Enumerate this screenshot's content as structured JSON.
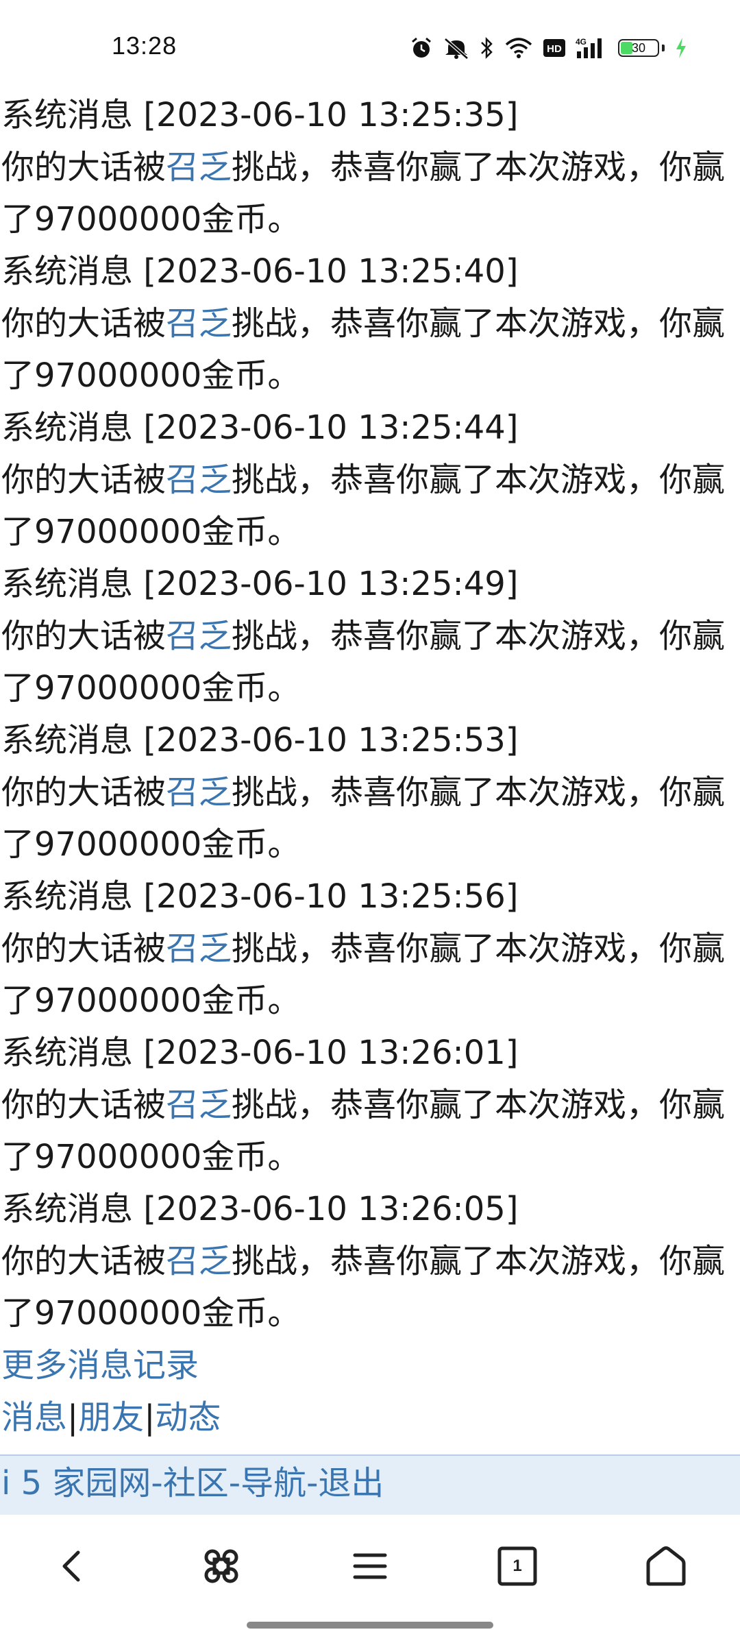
{
  "status_bar": {
    "time": "13:28",
    "battery_level": "30",
    "network": "4G",
    "hd_badge": "HD",
    "icons": [
      "alarm-icon",
      "mute-icon",
      "bluetooth-icon",
      "wifi-icon",
      "hd-icon",
      "signal-icon",
      "battery-icon",
      "charging-icon"
    ]
  },
  "messages": [
    {
      "header": "系统消息 [2023-06-10 13:25:35]",
      "pre": "你的大话被",
      "user": "召乏",
      "post": "挑战，恭喜你赢了本次游戏，你赢了97000000金币。"
    },
    {
      "header": "系统消息 [2023-06-10 13:25:40]",
      "pre": "你的大话被",
      "user": "召乏",
      "post": "挑战，恭喜你赢了本次游戏，你赢了97000000金币。"
    },
    {
      "header": "系统消息 [2023-06-10 13:25:44]",
      "pre": "你的大话被",
      "user": "召乏",
      "post": "挑战，恭喜你赢了本次游戏，你赢了97000000金币。"
    },
    {
      "header": "系统消息 [2023-06-10 13:25:49]",
      "pre": "你的大话被",
      "user": "召乏",
      "post": "挑战，恭喜你赢了本次游戏，你赢了97000000金币。"
    },
    {
      "header": "系统消息 [2023-06-10 13:25:53]",
      "pre": "你的大话被",
      "user": "召乏",
      "post": "挑战，恭喜你赢了本次游戏，你赢了97000000金币。"
    },
    {
      "header": "系统消息 [2023-06-10 13:25:56]",
      "pre": "你的大话被",
      "user": "召乏",
      "post": "挑战，恭喜你赢了本次游戏，你赢了97000000金币。"
    },
    {
      "header": "系统消息 [2023-06-10 13:26:01]",
      "pre": "你的大话被",
      "user": "召乏",
      "post": "挑战，恭喜你赢了本次游戏，你赢了97000000金币。"
    },
    {
      "header": "系统消息 [2023-06-10 13:26:05]",
      "pre": "你的大话被",
      "user": "召乏",
      "post": "挑战，恭喜你赢了本次游戏，你赢了97000000金币。"
    }
  ],
  "more_link": "更多消息记录",
  "tabs": {
    "messages": "消息",
    "friends": "朋友",
    "activity": "动态",
    "separator": "|"
  },
  "footer": {
    "site": "i 5 家园网",
    "community": "社区",
    "navigation": "导航",
    "logout": "退出",
    "separator": "-"
  },
  "browser_toolbar": {
    "tab_count": "1",
    "buttons": [
      "back-icon",
      "command-icon",
      "menu-icon",
      "tabs-icon",
      "home-icon"
    ]
  }
}
